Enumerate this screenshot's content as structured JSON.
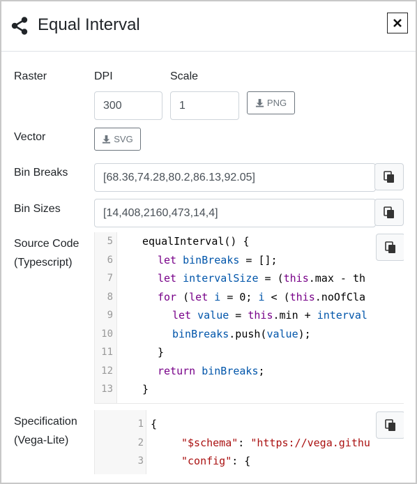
{
  "header": {
    "title": "Equal Interval",
    "share_icon": "share-icon",
    "close_label": "×"
  },
  "raster": {
    "label": "Raster",
    "dpi_label": "DPI",
    "scale_label": "Scale",
    "dpi_value": "300",
    "scale_value": "1",
    "png_label": "PNG"
  },
  "vector": {
    "label": "Vector",
    "svg_label": "SVG"
  },
  "bin_breaks": {
    "label": "Bin Breaks",
    "value": "[68.36,74.28,80.2,86.13,92.05]"
  },
  "bin_sizes": {
    "label": "Bin Sizes",
    "value": "[14,408,2160,473,14,4]"
  },
  "source_code": {
    "label_line1": "Source Code",
    "label_line2": "(Typescript)",
    "line_numbers": [
      "5",
      "6",
      "7",
      "8",
      "9",
      "10",
      "11",
      "12",
      "13"
    ]
  },
  "specification": {
    "label_line1": "Specification",
    "label_line2": "(Vega-Lite)",
    "line_numbers": [
      "1",
      "2",
      "3"
    ]
  },
  "colors": {
    "keyword": "#770088",
    "variable": "#0055aa",
    "string": "#aa1111"
  }
}
